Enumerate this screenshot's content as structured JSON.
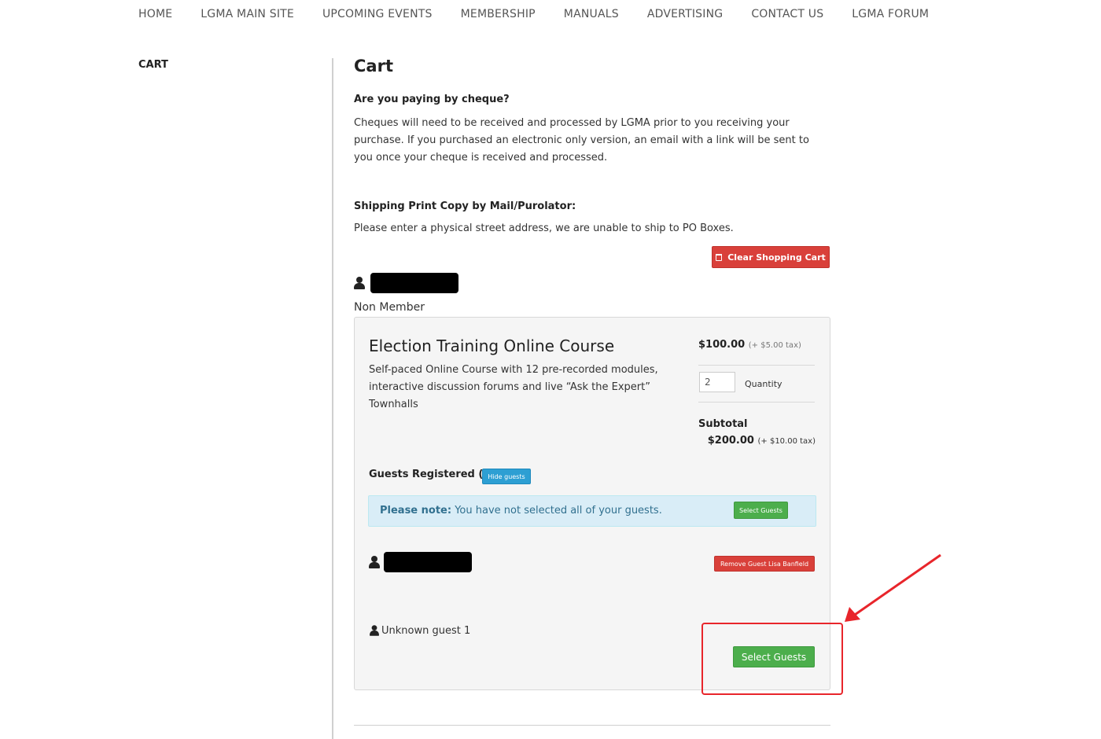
{
  "nav": {
    "items": [
      "HOME",
      "LGMA MAIN SITE",
      "UPCOMING EVENTS",
      "MEMBERSHIP",
      "MANUALS",
      "ADVERTISING",
      "CONTACT US",
      "LGMA FORUM"
    ]
  },
  "sidebar": {
    "title": "CART"
  },
  "page": {
    "title": "Cart",
    "cheque_heading": "Are you paying by cheque?",
    "cheque_text": "Cheques will need to be received and processed by LGMA prior to you receiving your purchase. If you purchased an electronic only version, an email with a link will be sent to you once your cheque is received and processed.",
    "shipping_heading": "Shipping Print Copy by Mail/Purolator:",
    "shipping_text": "Please enter a physical street address, we are unable to ship to PO Boxes.",
    "clear_cart_label": "Clear Shopping Cart",
    "member_type": "Non Member"
  },
  "item": {
    "title": "Election Training Online Course",
    "description": "Self-paced Online Course with 12 pre-recorded modules, interactive discussion forums and live “Ask the Expert” Townhalls",
    "price": "$100.00",
    "price_tax": "(+ $5.00 tax)",
    "quantity": "2",
    "quantity_label": "Quantity",
    "subtotal_label": "Subtotal",
    "subtotal": "$200.00",
    "subtotal_tax": "(+ $10.00 tax)",
    "guests_label": "Guests Registered (1/2)",
    "hide_guests_label": "Hide guests",
    "note_strong": "Please note:",
    "note_text": "You have not selected all of your guests.",
    "note_select_label": "Select Guests",
    "remove_guest_label": "Remove Guest Lisa Banfield",
    "unknown_guest": "Unknown guest 1",
    "select_guests_label": "Select Guests"
  },
  "colors": {
    "danger": "#d9403a",
    "success": "#4cae4c",
    "info": "#2d9fd3",
    "note_bg": "#d9edf7",
    "annotation": "#e8252b"
  }
}
